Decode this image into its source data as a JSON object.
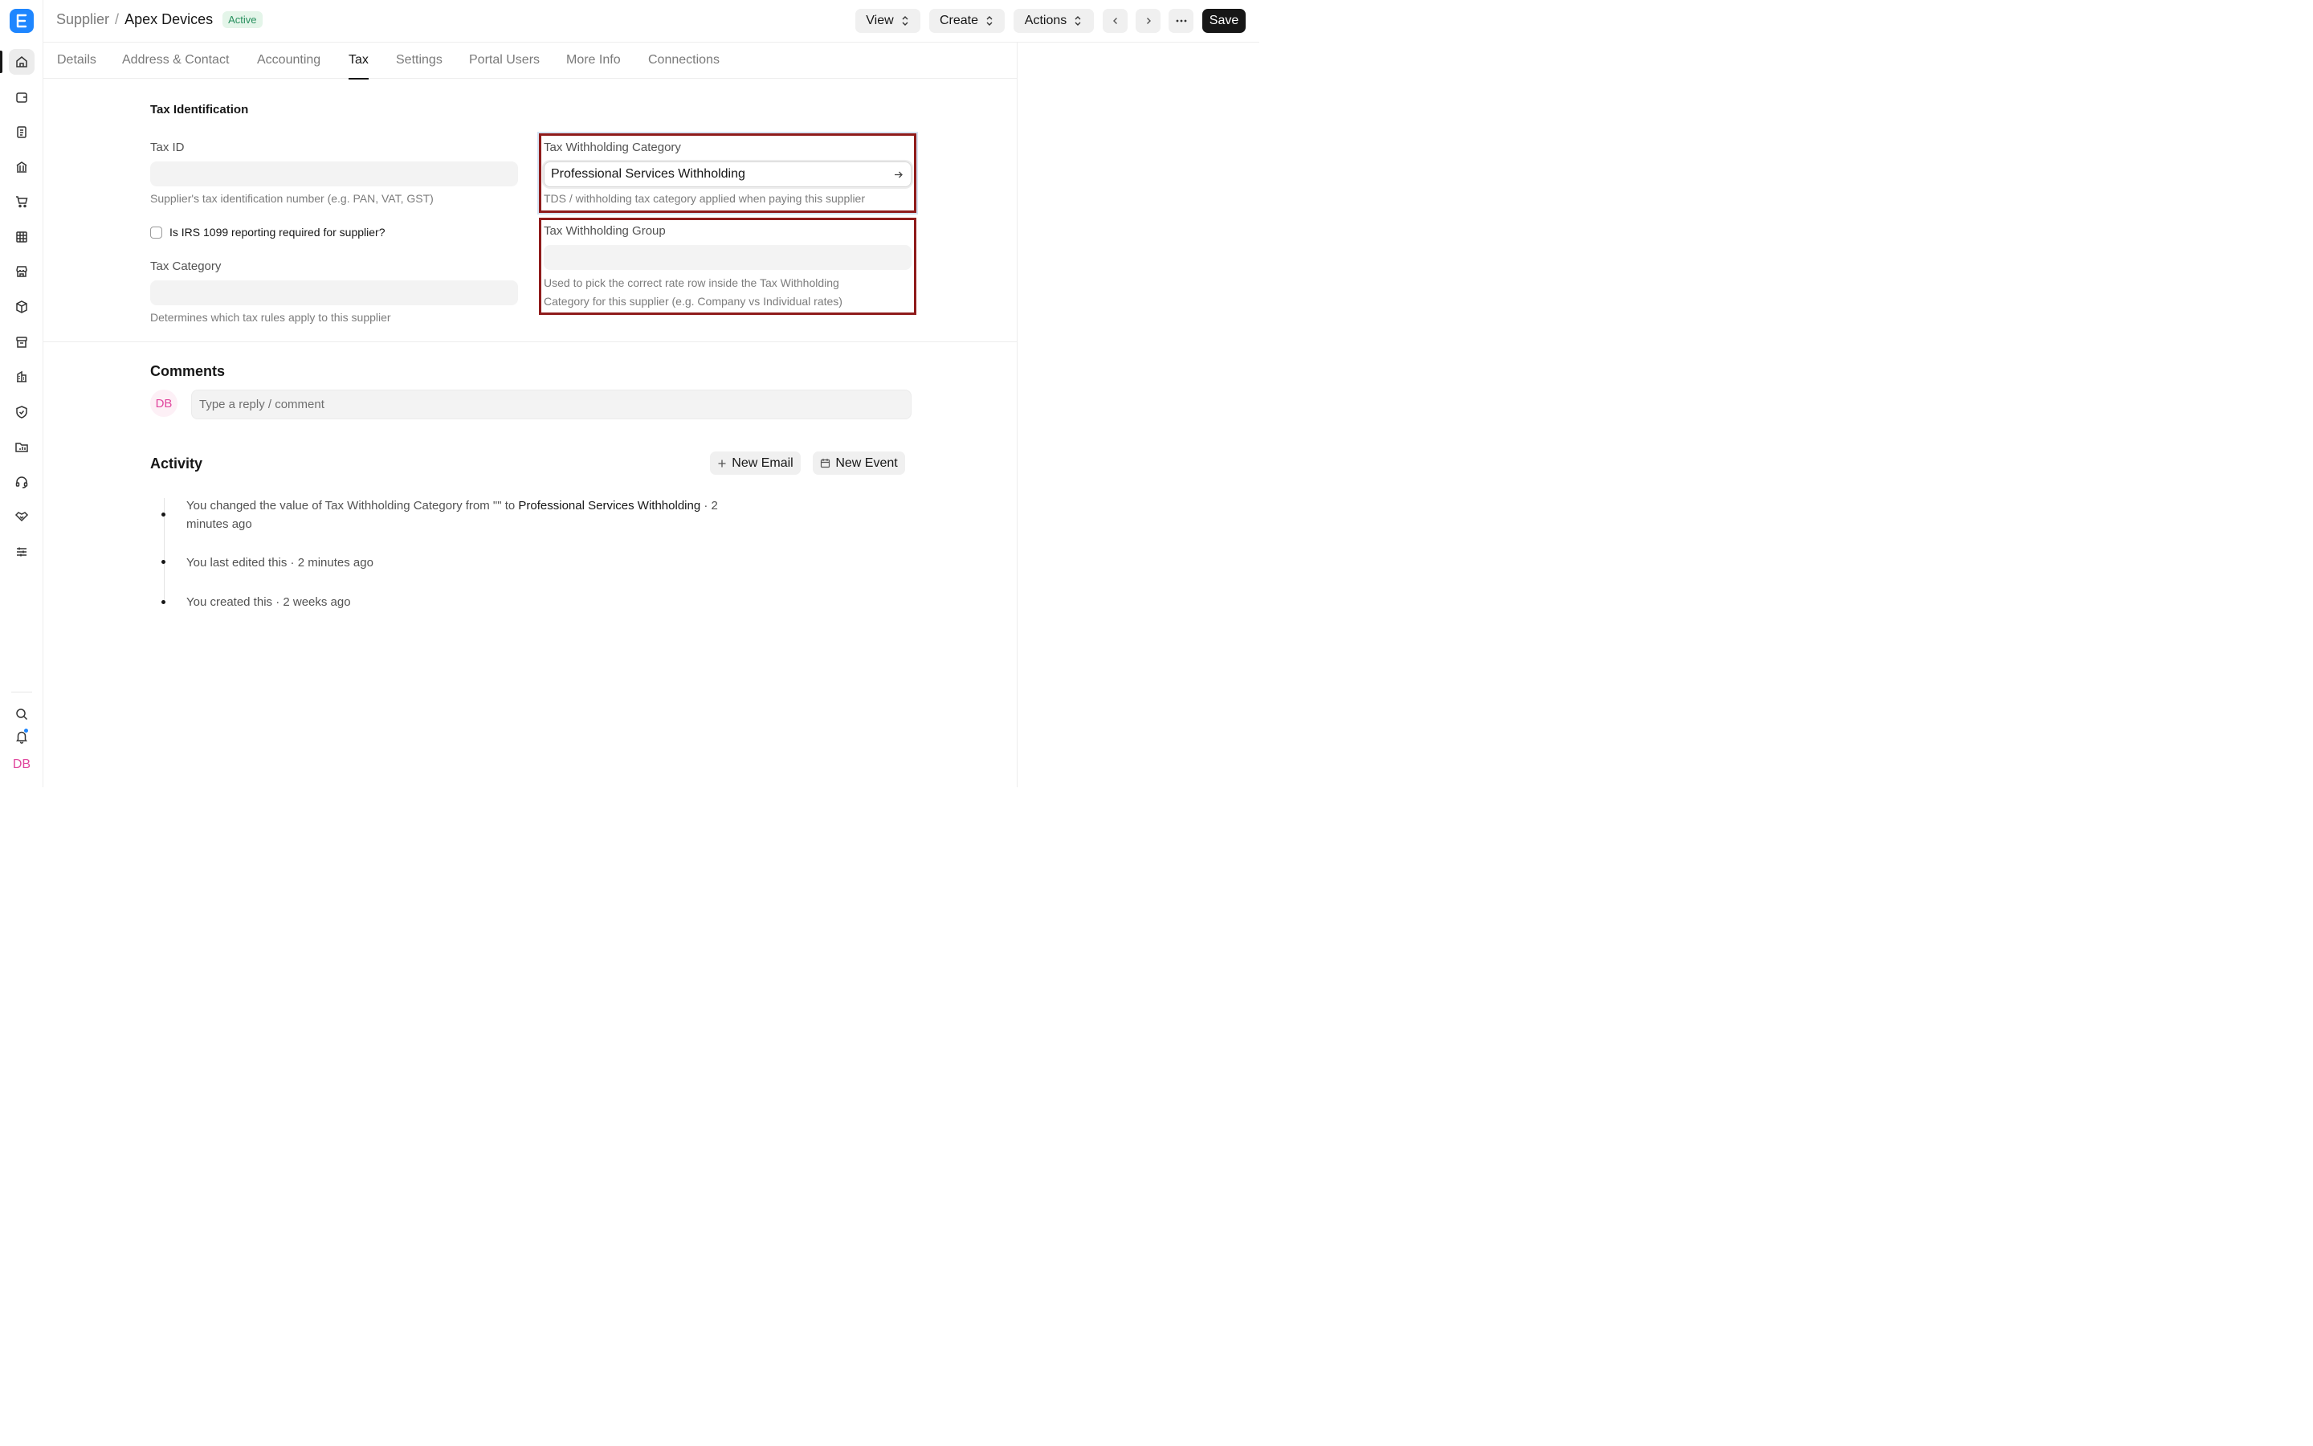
{
  "breadcrumb": {
    "parent": "Supplier",
    "separator": "/",
    "current": "Apex Devices",
    "status": "Active"
  },
  "header": {
    "view": "View",
    "create": "Create",
    "actions": "Actions",
    "save": "Save"
  },
  "tabs": [
    "Details",
    "Address & Contact",
    "Accounting",
    "Tax",
    "Settings",
    "Portal Users",
    "More Info",
    "Connections"
  ],
  "active_tab": "Tax",
  "tax_section": {
    "title": "Tax Identification",
    "tax_id": {
      "label": "Tax ID",
      "value": "",
      "description": "Supplier's tax identification number (e.g. PAN, VAT, GST)"
    },
    "irs_1099": {
      "label": "Is IRS 1099 reporting required for supplier?",
      "checked": false
    },
    "tax_category": {
      "label": "Tax Category",
      "value": "",
      "description": "Determines which tax rules apply to this supplier"
    },
    "withholding_category": {
      "label": "Tax Withholding Category",
      "value": "Professional Services Withholding",
      "description": "TDS / withholding tax category applied when paying this supplier"
    },
    "withholding_group": {
      "label": "Tax Withholding Group",
      "value": "",
      "description_line1": "Used to pick the correct rate row inside the Tax Withholding",
      "description_line2": "Category for this supplier (e.g. Company vs Individual rates)"
    }
  },
  "comments": {
    "title": "Comments",
    "avatar": "DB",
    "placeholder": "Type a reply / comment"
  },
  "activity": {
    "title": "Activity",
    "new_email": "New Email",
    "new_event": "New Event",
    "items": [
      {
        "pre": "You changed the value of Tax Withholding Category from \"\" to ",
        "strong": "Professional Services Withholding",
        "post": " · 2",
        "line2": "minutes ago"
      },
      {
        "text": "You last edited this · 2 minutes ago"
      },
      {
        "text": "You created this · 2 weeks ago"
      }
    ]
  },
  "sidebar": {
    "avatar": "DB"
  },
  "colors": {
    "accent": "#1e86ff",
    "highlight": "#8f1b1b",
    "active_badge": "#278f5e",
    "avatar": "#e0479e"
  }
}
